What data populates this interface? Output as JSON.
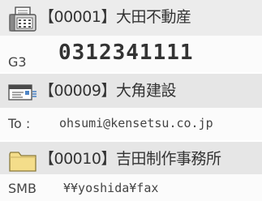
{
  "entries": [
    {
      "name": "【00001】大田不動産",
      "type_label": "G3",
      "destination": "0312341111",
      "icon": "fax-icon"
    },
    {
      "name": "【00009】大角建設",
      "type_label": "To :",
      "destination": "ohsumi@kensetsu.co.jp",
      "icon": "email-icon"
    },
    {
      "name": "【00010】吉田制作事務所",
      "type_label": "SMB",
      "destination": "¥¥yoshida¥fax",
      "icon": "folder-icon"
    }
  ],
  "colors": {
    "header_bg": "#e6e6e6",
    "detail_bg": "#fbfbfb",
    "folder_fill": "#f4dd8a",
    "text": "#333333"
  }
}
